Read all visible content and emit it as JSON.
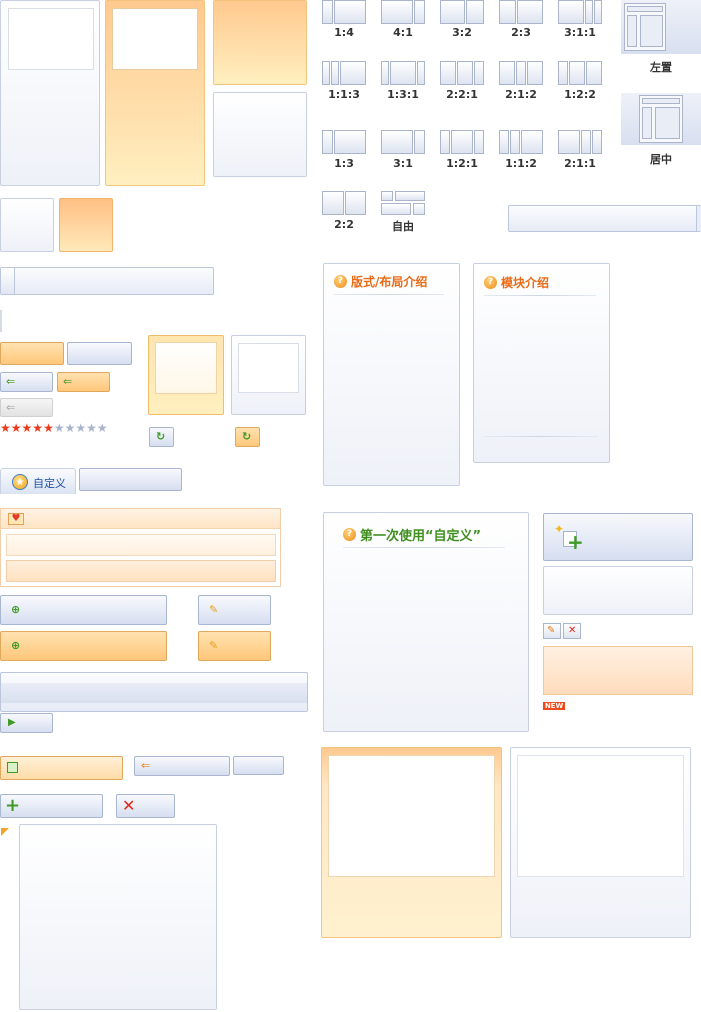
{
  "layout_thumbs": {
    "row1": [
      "1:4",
      "4:1",
      "3:2",
      "2:3",
      "3:1:1"
    ],
    "row2": [
      "1:1:3",
      "1:3:1",
      "2:2:1",
      "2:1:2",
      "1:2:2"
    ],
    "row3": [
      "1:3",
      "3:1",
      "1:2:1",
      "1:1:2",
      "2:1:1"
    ],
    "row4": [
      "2:2",
      "自由"
    ]
  },
  "position_thumbs": {
    "left": "左置",
    "center": "居中"
  },
  "panels": {
    "layout_intro": "版式/布局介绍",
    "module_intro": "模块介绍",
    "first_use": "第一次使用“自定义”"
  },
  "custom_tab": "自定义",
  "new_badge": "NEW",
  "rating": {
    "filled": 5,
    "total": 9
  },
  "colors": {
    "accent_orange": "#ea6a15",
    "panel_blue_border": "#c8cfe0",
    "panel_orange": "#ffc98f",
    "heading_green": "#3f8f1e"
  },
  "icons": [
    "back-arrow-icon",
    "refresh-icon",
    "heart-icon",
    "add-page-icon",
    "edit-magic-icon",
    "play-icon",
    "save-icon",
    "plus-icon",
    "close-x-icon",
    "star-icon",
    "question-icon",
    "edit-icon",
    "delete-icon",
    "sparkle-add-icon",
    "customize-star-icon"
  ]
}
